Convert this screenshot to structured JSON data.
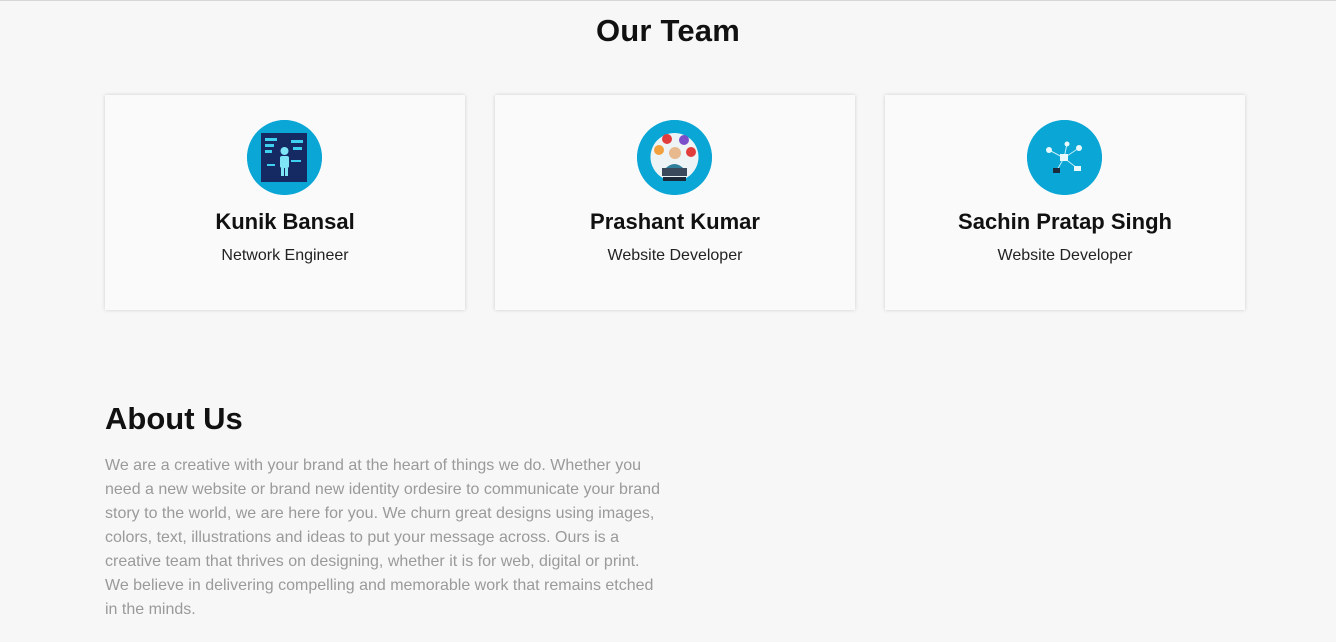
{
  "team": {
    "title": "Our Team",
    "members": [
      {
        "name": "Kunik Bansal",
        "role": "Network Engineer",
        "avatar_icon": "network-engineer-avatar-icon"
      },
      {
        "name": "Prashant Kumar",
        "role": "Website Developer",
        "avatar_icon": "web-developer-avatar-icon"
      },
      {
        "name": "Sachin Pratap Singh",
        "role": "Website Developer",
        "avatar_icon": "network-devices-avatar-icon"
      }
    ]
  },
  "about": {
    "title": "About Us",
    "text": "We are a creative with your brand at the heart of things we do. Whether you need a new website or brand new identity ordesire to communicate your brand story to the world, we are here for you. We churn great designs using images, colors, text, illustrations and ideas to put your message across. Ours is a creative team that thrives on designing, whether it is for web, digital or print. We believe in delivering compelling and memorable work that remains etched in the minds."
  },
  "colors": {
    "accent": "#0aa6d6",
    "background": "#f7f7f7",
    "card": "#fafafa",
    "muted_text": "#9a9a9a"
  }
}
